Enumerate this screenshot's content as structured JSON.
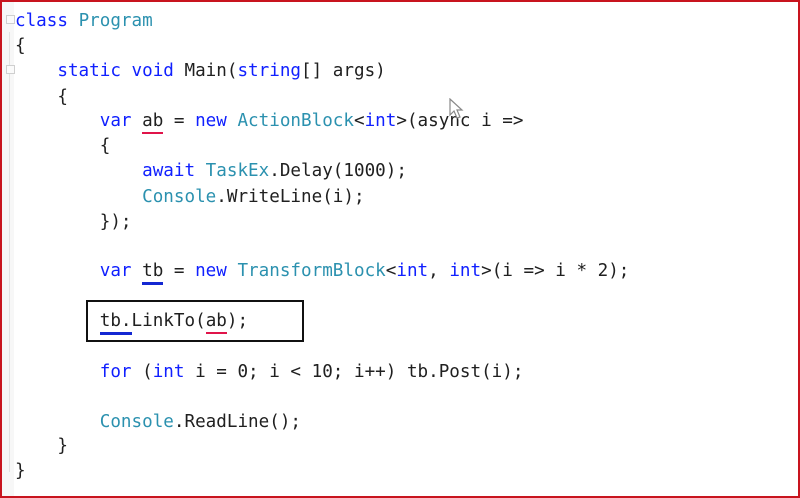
{
  "code": {
    "lines": [
      [
        {
          "t": "class ",
          "c": "kw"
        },
        {
          "t": "Program",
          "c": "ty"
        }
      ],
      [
        {
          "t": "{"
        }
      ],
      [
        {
          "t": "    "
        },
        {
          "t": "static",
          "c": "kw"
        },
        {
          "t": " "
        },
        {
          "t": "void",
          "c": "kw"
        },
        {
          "t": " Main("
        },
        {
          "t": "string",
          "c": "kw"
        },
        {
          "t": "[] args)"
        }
      ],
      [
        {
          "t": "    {"
        }
      ],
      [
        {
          "t": "        "
        },
        {
          "t": "var",
          "c": "kw"
        },
        {
          "t": " "
        },
        {
          "t": "ab",
          "u": "red"
        },
        {
          "t": " = "
        },
        {
          "t": "new",
          "c": "kw"
        },
        {
          "t": " "
        },
        {
          "t": "ActionBlock",
          "c": "ty"
        },
        {
          "t": "<"
        },
        {
          "t": "int",
          "c": "kw"
        },
        {
          "t": ">(async i =>"
        }
      ],
      [
        {
          "t": "        {"
        }
      ],
      [
        {
          "t": "            "
        },
        {
          "t": "await",
          "c": "kw"
        },
        {
          "t": " "
        },
        {
          "t": "TaskEx",
          "c": "ty"
        },
        {
          "t": ".Delay(1000);"
        }
      ],
      [
        {
          "t": "            "
        },
        {
          "t": "Console",
          "c": "ty"
        },
        {
          "t": ".WriteLine(i);"
        }
      ],
      [
        {
          "t": "        });"
        }
      ],
      [],
      [
        {
          "t": "        "
        },
        {
          "t": "var",
          "c": "kw"
        },
        {
          "t": " "
        },
        {
          "t": "tb",
          "u": "blue"
        },
        {
          "t": " = "
        },
        {
          "t": "new",
          "c": "kw"
        },
        {
          "t": " "
        },
        {
          "t": "TransformBlock",
          "c": "ty"
        },
        {
          "t": "<"
        },
        {
          "t": "int",
          "c": "kw"
        },
        {
          "t": ", "
        },
        {
          "t": "int",
          "c": "kw"
        },
        {
          "t": ">(i => i * 2);"
        }
      ],
      [],
      [
        {
          "t": "        "
        },
        {
          "t": "tb.",
          "u": "blue"
        },
        {
          "t": "LinkTo("
        },
        {
          "t": "ab",
          "u": "red"
        },
        {
          "t": ");"
        }
      ],
      [],
      [
        {
          "t": "        "
        },
        {
          "t": "for",
          "c": "kw"
        },
        {
          "t": " ("
        },
        {
          "t": "int",
          "c": "kw"
        },
        {
          "t": " i = 0; i < 10; i++) tb.Post(i);"
        }
      ],
      [],
      [
        {
          "t": "        "
        },
        {
          "t": "Console",
          "c": "ty"
        },
        {
          "t": ".ReadLine();"
        }
      ],
      [
        {
          "t": "    }"
        }
      ],
      [
        {
          "t": "}"
        }
      ]
    ]
  },
  "colors": {
    "keyword": "#1020ff",
    "type": "#2b91af",
    "plain": "#202020",
    "underline_red": "#e0144a",
    "underline_blue": "#1428d2",
    "frame": "#c8141e"
  }
}
